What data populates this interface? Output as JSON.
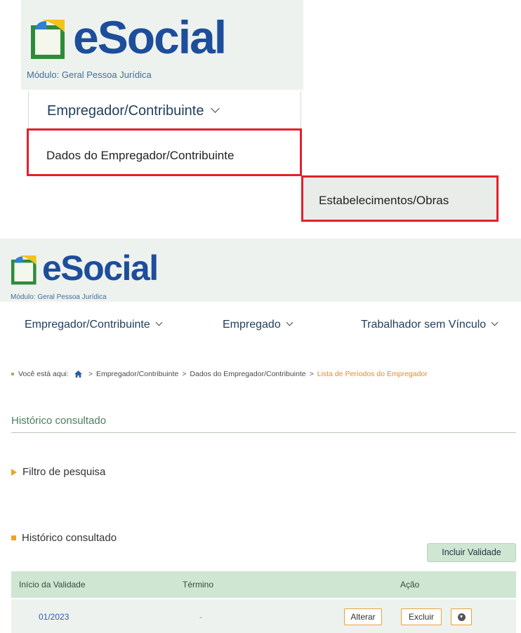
{
  "top_panel": {
    "logo": "eSocial",
    "module": "Módulo: Geral Pessoa Jurídica",
    "menu_label": "Empregador/Contribuinte",
    "submenu_item_1": "Dados do Empregador/Contribuinte",
    "submenu_item_2": "Estabelecimentos/Obras"
  },
  "header": {
    "logo": "eSocial",
    "module": "Módulo: Geral Pessoa Jurídica"
  },
  "nav": [
    {
      "label": "Empregador/Contribuinte"
    },
    {
      "label": "Empregado"
    },
    {
      "label": "Trabalhador sem Vínculo"
    }
  ],
  "breadcrumb": {
    "prefix": "Você está aqui:",
    "items": [
      "Empregador/Contribuinte",
      "Dados do Empregador/Contribuinte"
    ],
    "current": "Lista de Períodos do Empregador"
  },
  "page_title": "Histórico consultado",
  "filter_label": "Filtro de pesquisa",
  "history_label": "Histórico consultado",
  "add_button": "Incluir Validade",
  "table": {
    "columns": [
      "Início da Validade",
      "Término",
      "Ação"
    ],
    "rows": [
      {
        "inicio": "01/2023",
        "termino": "-",
        "alterar": "Alterar",
        "excluir": "Excluir"
      }
    ]
  },
  "colors": {
    "logo_blue": "#1d4e9b",
    "highlight_red": "#e3202b",
    "accent_orange": "#f0a227",
    "table_header_green": "#cfe6d3"
  }
}
